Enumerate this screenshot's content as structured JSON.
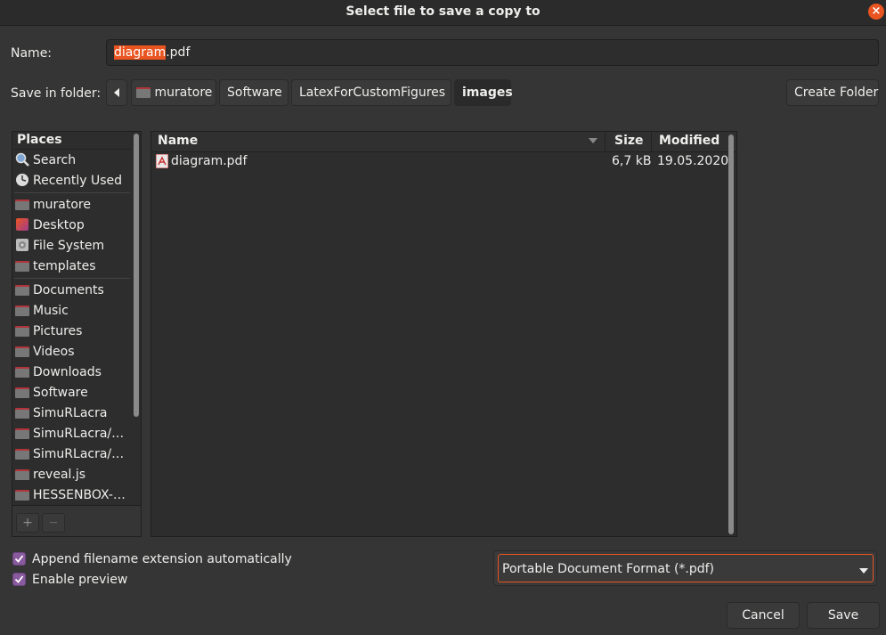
{
  "window": {
    "title": "Select file to save a copy to",
    "close_glyph": "×"
  },
  "name_field": {
    "label": "Name:",
    "selected_part": "diagram",
    "rest": ".pdf"
  },
  "folder": {
    "label": "Save in folder:",
    "crumbs": [
      "muratore",
      "Software",
      "LatexForCustomFigures",
      "images"
    ],
    "create_label": "Create Folder"
  },
  "places": {
    "header": "Places",
    "items": [
      "Search",
      "Recently Used",
      "muratore",
      "Desktop",
      "File System",
      "templates",
      "Documents",
      "Music",
      "Pictures",
      "Videos",
      "Downloads",
      "Software",
      "SimuRLacra",
      "SimuRLacra/…",
      "SimuRLacra/…",
      "reveal.js",
      "HESSENBOX-…"
    ],
    "add_glyph": "+",
    "remove_glyph": "—"
  },
  "files": {
    "columns": {
      "name": "Name",
      "size": "Size",
      "modified": "Modified"
    },
    "rows": [
      {
        "name": "diagram.pdf",
        "size": "6,7 kB",
        "modified": "19.05.2020"
      }
    ]
  },
  "options": {
    "append_ext": "Append filename extension automatically",
    "enable_preview": "Enable preview"
  },
  "filter": {
    "selected": "Portable Document Format (*.pdf)"
  },
  "buttons": {
    "cancel": "Cancel",
    "save": "Save"
  },
  "colors": {
    "accent": "#e95420",
    "check": "#8a5a9e",
    "folder": "#b0343a"
  }
}
